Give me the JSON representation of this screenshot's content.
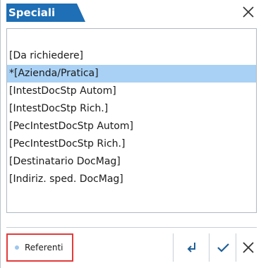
{
  "dialog": {
    "title": "Speciali",
    "close_icon": "close-icon"
  },
  "list": {
    "items": [
      {
        "label": "[Da richiedere]",
        "selected": false
      },
      {
        "label": "*[Azienda/Pratica]",
        "selected": true
      },
      {
        "label": "[IntestDocStp Autom]",
        "selected": false
      },
      {
        "label": "[IntestDocStp Rich.]",
        "selected": false
      },
      {
        "label": "[PecIntestDocStp Autom]",
        "selected": false
      },
      {
        "label": "[PecIntestDocStp Rich.]",
        "selected": false
      },
      {
        "label": "[Destinatario DocMag]",
        "selected": false
      },
      {
        "label": "[Indiriz. sped. DocMag]",
        "selected": false
      }
    ]
  },
  "footer": {
    "referenti_label": "Referenti",
    "buttons": [
      "enter-icon",
      "checkmark-icon",
      "close-icon"
    ]
  },
  "colors": {
    "title_bg": "#1e6fb5",
    "selection_bg": "#a8d1f5",
    "highlight_border": "#e23b3b",
    "icon_color": "#1e5f96"
  }
}
